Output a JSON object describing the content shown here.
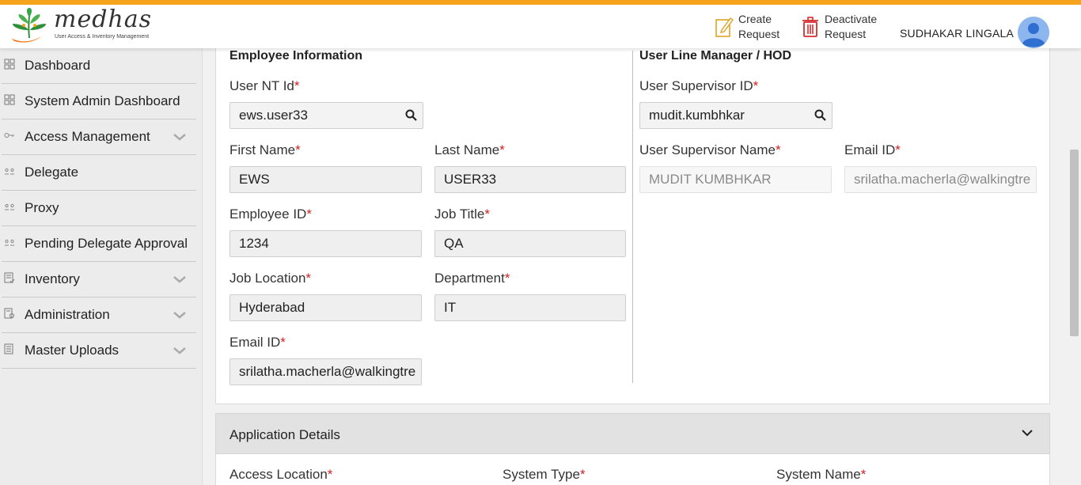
{
  "header": {
    "logo_name": "medhas",
    "logo_tagline": "User Access & Inventory Management",
    "create_request": [
      "Create",
      "Request"
    ],
    "deactivate_request": [
      "Deactivate",
      "Request"
    ],
    "username": "SUDHAKAR LINGALA",
    "accent_color": "#f5a31a"
  },
  "sidebar": {
    "items": [
      {
        "label": "Dashboard",
        "icon": "grid-icon",
        "expandable": false
      },
      {
        "label": "System Admin Dashboard",
        "icon": "grid-icon",
        "expandable": false
      },
      {
        "label": "Access Management",
        "icon": "key-icon",
        "expandable": true
      },
      {
        "label": "Delegate",
        "icon": "users-icon",
        "expandable": false
      },
      {
        "label": "Proxy",
        "icon": "users-icon",
        "expandable": false
      },
      {
        "label": "Pending Delegate Approval",
        "icon": "users-icon",
        "expandable": false
      },
      {
        "label": "Inventory",
        "icon": "inventory-icon",
        "expandable": true
      },
      {
        "label": "Administration",
        "icon": "admin-icon",
        "expandable": true
      },
      {
        "label": "Master Uploads",
        "icon": "upload-icon",
        "expandable": true
      }
    ]
  },
  "employee": {
    "title": "Employee Information",
    "nt_id": {
      "label": "User NT Id",
      "value": "ews.user33"
    },
    "first_name": {
      "label": "First Name",
      "value": "EWS"
    },
    "last_name": {
      "label": "Last Name",
      "value": "USER33"
    },
    "employee_id": {
      "label": "Employee ID",
      "value": "1234"
    },
    "job_title": {
      "label": "Job Title",
      "value": "QA"
    },
    "job_location": {
      "label": "Job Location",
      "value": "Hyderabad"
    },
    "department": {
      "label": "Department",
      "value": "IT"
    },
    "email": {
      "label": "Email ID",
      "value": "srilatha.macherla@walkingtre"
    }
  },
  "manager": {
    "title": "User Line Manager / HOD",
    "supervisor_id": {
      "label": "User Supervisor ID",
      "value": "mudit.kumbhkar"
    },
    "supervisor_name": {
      "label": "User Supervisor Name",
      "value": "MUDIT KUMBHKAR"
    },
    "email": {
      "label": "Email ID",
      "value": "srilatha.macherla@walkingtre"
    }
  },
  "application": {
    "title": "Application Details",
    "access_location": "Access Location",
    "system_type": "System Type",
    "system_name": "System Name"
  },
  "required_marker": "*"
}
